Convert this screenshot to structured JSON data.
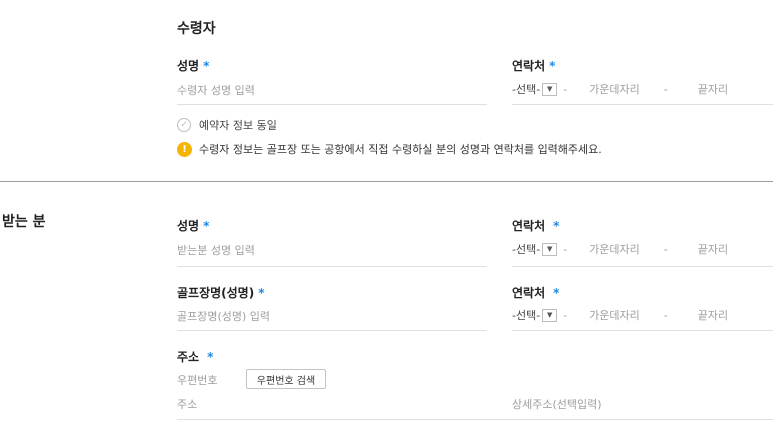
{
  "recipient": {
    "title": "수령자",
    "name_label": "성명",
    "name_placeholder": "수령자 성명 입력",
    "contact_label": "연락처",
    "phone": {
      "select": "-선택-",
      "dash1": "-",
      "middle": "가운데자리",
      "dash2": "-",
      "last": "끝자리"
    },
    "same_as_booker": "예약자 정보 동일",
    "info_note": "수령자 정보는 골프장 또는 공항에서 직접 수령하실 분의 성명과 연락처를 입력해주세요.",
    "required_mark": "*"
  },
  "receiver": {
    "title": "받는 분",
    "name_label": "성명",
    "name_placeholder": "받는분 성명 입력",
    "contact_label": "연락처",
    "phone": {
      "select": "-선택-",
      "dash1": "-",
      "middle": "가운데자리",
      "dash2": "-",
      "last": "끝자리"
    },
    "golf_label": "골프장명(성명)",
    "golf_placeholder": "골프장명(성명) 입력",
    "contact2_label": "연락처",
    "phone2": {
      "select": "-선택-",
      "dash1": "-",
      "middle": "가운데자리",
      "dash2": "-",
      "last": "끝자리"
    },
    "address_label": "주소",
    "zip_placeholder": "우편번호",
    "zip_search_button": "우편번호 검색",
    "address_placeholder": "주소",
    "detail_address_placeholder": "상세주소(선택입력)",
    "required_mark": "*"
  },
  "icons": {
    "select_arrow": "chevron-down-icon",
    "checkbox": "check-circle-icon",
    "info": "info-icon"
  },
  "colors": {
    "required_star": "#1e88e5",
    "info_icon": "#f5b400"
  }
}
